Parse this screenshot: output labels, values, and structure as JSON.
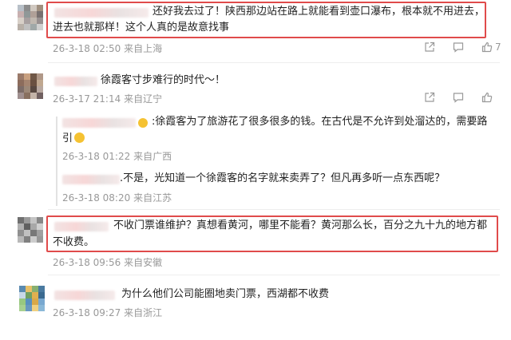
{
  "comments": [
    {
      "text_line1": "还好我去过了！陕西那边站在路上就能看到壶口瀑布，根本就不用进去，",
      "text_line2": "进去也就那样！这个人真的是故意找事",
      "date": "26-3-18 02:50",
      "location": "来自上海",
      "likes": "7",
      "avatar_colors": [
        "#b8c0c8",
        "#8c8c8c",
        "#d0c8c0",
        "#a09080",
        "#c8b0b0",
        "#909898",
        "#b0a098",
        "#787070",
        "#d8d0c8",
        "#a8a0a0",
        "#c0b8b0",
        "#989090",
        "#b8b0a8",
        "#c0c0c0",
        "#a0a8a8",
        "#d0d0d0"
      ]
    },
    {
      "text": "徐霞客寸步难行的时代～！",
      "date": "26-3-17 21:14",
      "location": "来自辽宁",
      "avatar_colors": [
        "#9a7a6a",
        "#c8a080",
        "#705848",
        "#b09888",
        "#8c6c5c",
        "#a48470",
        "#6a5040",
        "#c0a890",
        "#7c6c68",
        "#9c8878",
        "#584840",
        "#b8a8a0",
        "#a09090",
        "#887060",
        "#c4b4a8",
        "#706060"
      ],
      "replies": [
        {
          "text_line1": "徐霞客为了旅游花了很多很多的钱。在古代是不允许到处溜达的，需要路",
          "text_line2": "引",
          "date": "26-3-18 01:22",
          "location": "来自广西"
        },
        {
          "text": ".不是，光知道一个徐霞客的名字就来卖弄了？但凡再多听一点东西呢？",
          "date": "26-3-18 08:20",
          "location": "来自江苏"
        }
      ]
    },
    {
      "text_line1": "不收门票谁维护？真想看黄河，哪里不能看？黄河那么长，百分之九十九的地方都",
      "text_line2": "不收费。",
      "date": "26-3-18 09:56",
      "location": "来自安徽",
      "avatar_colors": [
        "#707070",
        "#9a9a9a",
        "#c4c4c4",
        "#888888",
        "#b0b0b0",
        "#606060",
        "#a8a8a8",
        "#d0d0d0",
        "#909090",
        "#c0c0c0",
        "#787878",
        "#a0a0a0",
        "#b8b8b8",
        "#808080",
        "#cccccc",
        "#989898"
      ]
    },
    {
      "text": "为什么他们公司能圈地卖门票，西湖都不收费",
      "date": "26-3-18 09:27",
      "location": "来自浙江",
      "avatar_colors": [
        "#5a8ab0",
        "#e8c068",
        "#88b070",
        "#4a7aa0",
        "#c8d8e8",
        "#70a060",
        "#e0b050",
        "#3a6a90",
        "#98c880",
        "#5890c0",
        "#d8a848",
        "#78a8d0",
        "#a8d090",
        "#6898c0",
        "#f0d080",
        "#8ab8d8"
      ]
    }
  ],
  "icons": {
    "share": "share-icon",
    "comment": "comment-icon",
    "like": "like-icon"
  },
  "colors": {
    "highlight": "#e04b4b",
    "meta": "#999999"
  }
}
